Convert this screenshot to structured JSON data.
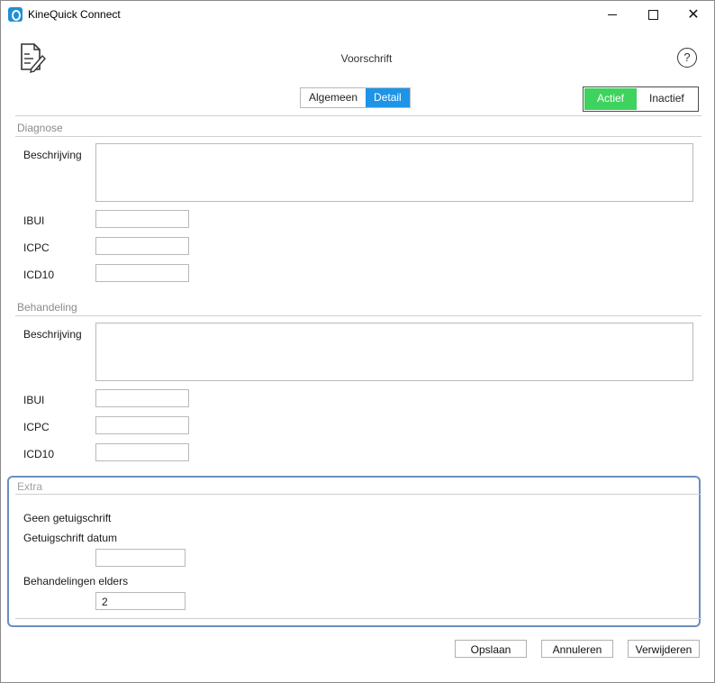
{
  "window": {
    "title": "KineQuick Connect"
  },
  "header": {
    "title": "Voorschrift",
    "help": "?"
  },
  "tabs": [
    {
      "label": "Algemeen"
    },
    {
      "label": "Detail"
    }
  ],
  "status": {
    "active_label": "Actief",
    "inactive_label": "Inactief"
  },
  "diagnose": {
    "title": "Diagnose",
    "beschrijving_label": "Beschrijving",
    "ibui_label": "IBUI",
    "icpc_label": "ICPC",
    "icd10_label": "ICD10"
  },
  "behandeling": {
    "title": "Behandeling",
    "beschrijving_label": "Beschrijving",
    "ibui_label": "IBUI",
    "icpc_label": "ICPC",
    "icd10_label": "ICD10"
  },
  "extra": {
    "title": "Extra",
    "geen_getuigschrift": "Geen getuigschrift",
    "getuigschrift_datum_label": "Getuigschrift datum",
    "behandelingen_elders_label": "Behandelingen elders",
    "behandelingen_elders_value": "2"
  },
  "buttons": {
    "save": "Opslaan",
    "cancel": "Annuleren",
    "delete": "Verwijderen"
  },
  "colors": {
    "accent_blue": "#1e94e8",
    "active_green": "#3ed25e",
    "focus_border": "#6a8fbf"
  },
  "icons": {
    "app": "kinequick-icon",
    "document": "document-edit-icon",
    "help": "help-icon"
  }
}
